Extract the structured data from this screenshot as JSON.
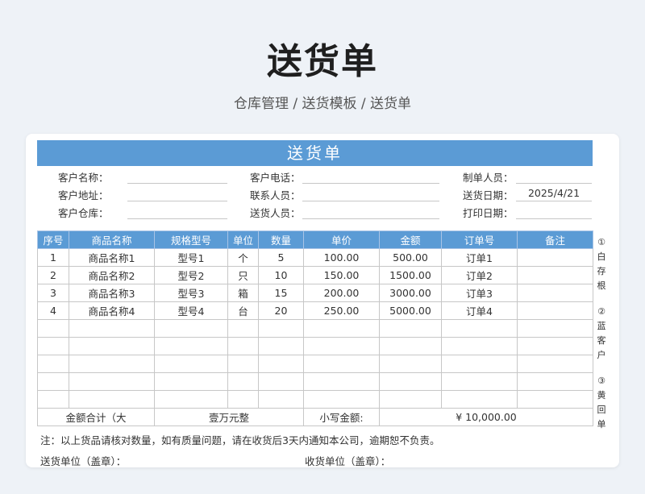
{
  "page": {
    "title": "送货单",
    "breadcrumb": "仓库管理 / 送货模板 / 送货单"
  },
  "doc": {
    "header": "送货单",
    "info": {
      "customer_name_label": "客户名称：",
      "customer_phone_label": "客户电话：",
      "maker_label": "制单人员：",
      "customer_address_label": "客户地址：",
      "contact_label": "联系人员：",
      "ship_date_label": "送货日期：",
      "ship_date_value": "2025/4/21",
      "customer_warehouse_label": "客户仓库：",
      "deliverer_label": "送货人员：",
      "print_date_label": "打印日期："
    },
    "columns": [
      "序号",
      "商品名称",
      "规格型号",
      "单位",
      "数量",
      "单价",
      "金额",
      "订单号",
      "备注"
    ],
    "rows": [
      [
        "1",
        "商品名称1",
        "型号1",
        "个",
        "5",
        "100.00",
        "500.00",
        "订单1",
        ""
      ],
      [
        "2",
        "商品名称2",
        "型号2",
        "只",
        "10",
        "150.00",
        "1500.00",
        "订单2",
        ""
      ],
      [
        "3",
        "商品名称3",
        "型号3",
        "箱",
        "15",
        "200.00",
        "3000.00",
        "订单3",
        ""
      ],
      [
        "4",
        "商品名称4",
        "型号4",
        "台",
        "20",
        "250.00",
        "5000.00",
        "订单4",
        ""
      ],
      [
        "",
        "",
        "",
        "",
        "",
        "",
        "",
        "",
        ""
      ],
      [
        "",
        "",
        "",
        "",
        "",
        "",
        "",
        "",
        ""
      ],
      [
        "",
        "",
        "",
        "",
        "",
        "",
        "",
        "",
        ""
      ],
      [
        "",
        "",
        "",
        "",
        "",
        "",
        "",
        "",
        ""
      ],
      [
        "",
        "",
        "",
        "",
        "",
        "",
        "",
        "",
        ""
      ]
    ],
    "total": {
      "label_upper": "金额合计（大",
      "upper_value": "壹万元整",
      "label_lower": "小写金额:",
      "lower_value": "¥ 10,000.00"
    },
    "side_notes": [
      [
        "①",
        "白",
        "存",
        "根"
      ],
      [
        "②",
        "蓝",
        "客",
        "户"
      ],
      [
        "③",
        "黄",
        "回",
        "单"
      ]
    ],
    "note": "注：以上货品请核对数量，如有质量问题，请在收货后3天内通知本公司，逾期恕不负责。",
    "sender_sign": "送货单位（盖章）：",
    "receiver_sign": "收货单位（盖章）："
  }
}
